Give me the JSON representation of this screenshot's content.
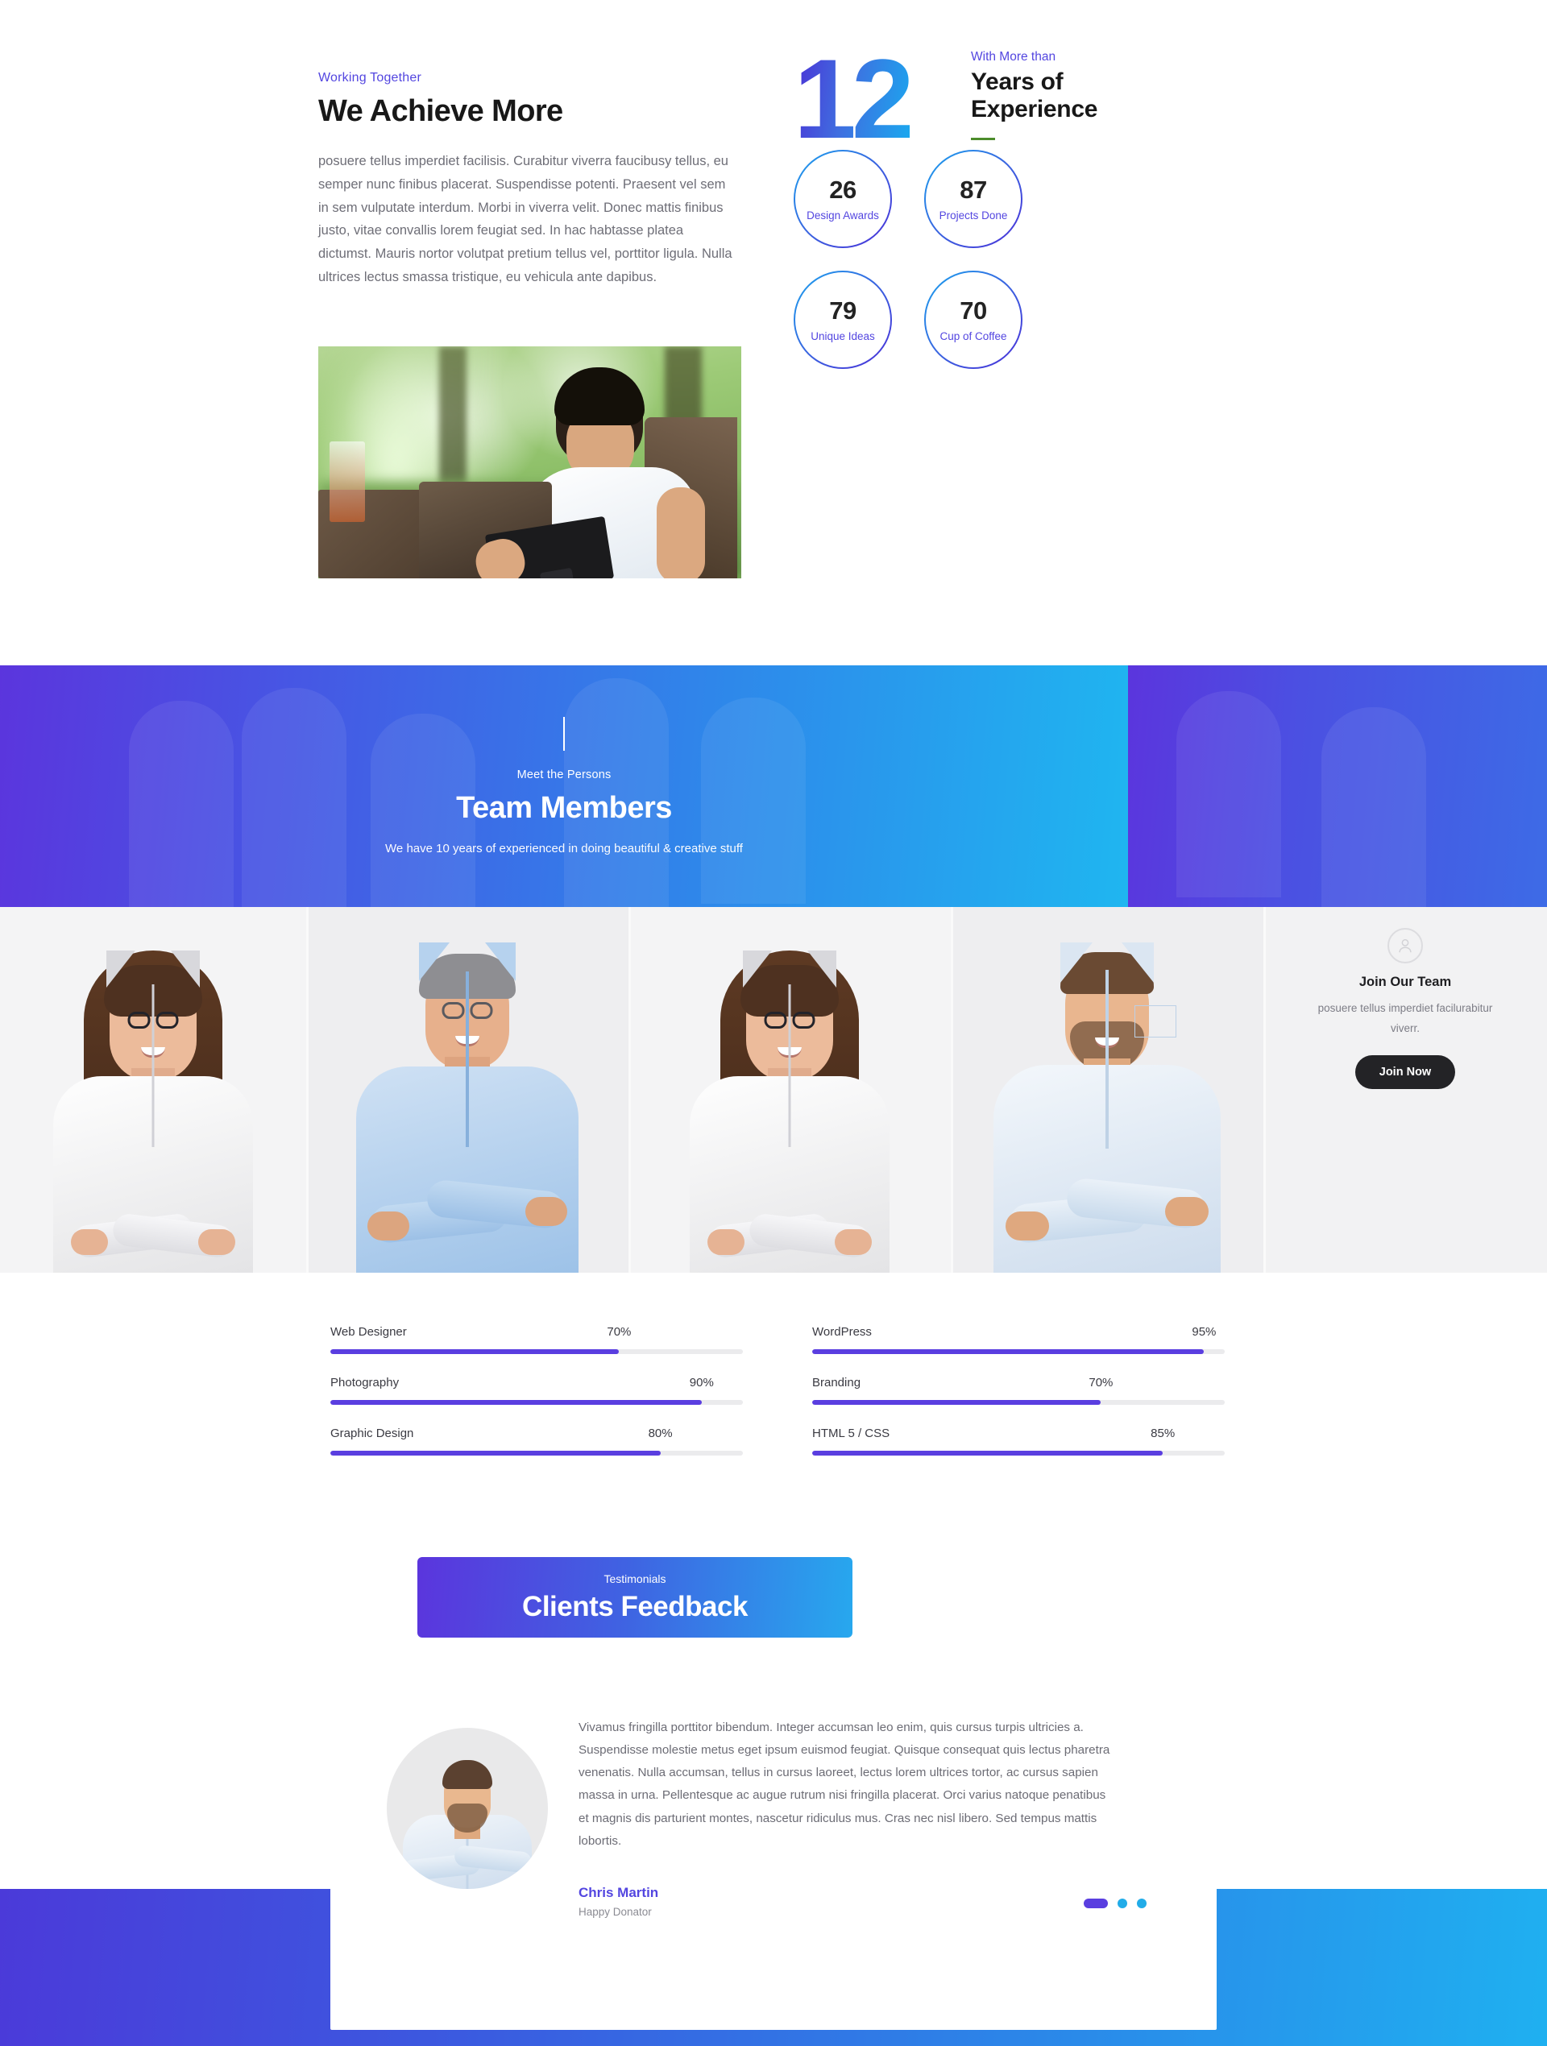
{
  "colors": {
    "accent_purple": "#5346e0",
    "accent_blue": "#1fb0f0",
    "gradient_start": "#5b35dd",
    "gradient_end": "#1fb6f0",
    "dark": "#232326",
    "green_rule": "#4c8c2b"
  },
  "achieve": {
    "eyebrow": "Working Together",
    "title": "We Achieve More",
    "body": "posuere tellus imperdiet facilisis. Curabitur viverra faucibusy tellus, eu semper nunc finibus placerat. Suspendisse potenti. Praesent vel sem in sem vulputate interdum. Morbi in viverra velit. Donec mattis finibus justo, vitae convallis lorem feugiat sed. In hac habtasse platea dictumst. Mauris nortor volutpat pretium tellus vel, porttitor ligula. Nulla ultrices lectus smassa tristique, eu vehicula ante dapibus.",
    "photo_alt": "man-with-tablet-photo"
  },
  "experience": {
    "number": "12",
    "eyebrow": "With More than",
    "title_line1": "Years of",
    "title_line2": "Experience"
  },
  "stats": [
    {
      "value": "26",
      "label": "Design Awards"
    },
    {
      "value": "87",
      "label": "Projects Done"
    },
    {
      "value": "79",
      "label": "Unique Ideas"
    },
    {
      "value": "70",
      "label": "Cup of Coffee"
    }
  ],
  "team_banner": {
    "eyebrow": "Meet the Persons",
    "title": "Team Members",
    "subtitle": "We have 10 years of experienced in doing beautiful & creative stuff"
  },
  "team_members": [
    {
      "photo_alt": "woman-with-glasses-photo-1"
    },
    {
      "photo_alt": "grey-haired-man-photo"
    },
    {
      "photo_alt": "woman-with-glasses-photo-2"
    },
    {
      "photo_alt": "bearded-man-photo"
    }
  ],
  "join": {
    "icon": "user-icon",
    "title": "Join Our Team",
    "description": "posuere tellus imperdiet facilurabitur viverr.",
    "button_label": "Join Now"
  },
  "skills": [
    {
      "name": "Web Designer",
      "percent": "70%",
      "value": 70
    },
    {
      "name": "WordPress",
      "percent": "95%",
      "value": 95
    },
    {
      "name": "Photography",
      "percent": "90%",
      "value": 90
    },
    {
      "name": "Branding",
      "percent": "70%",
      "value": 70
    },
    {
      "name": "Graphic Design",
      "percent": "80%",
      "value": 80
    },
    {
      "name": "HTML 5 / CSS",
      "percent": "85%",
      "value": 85
    }
  ],
  "feedback": {
    "eyebrow": "Testimonials",
    "title": "Clients Feedback"
  },
  "testimonial": {
    "avatar_alt": "chris-martin-avatar",
    "quote": "Vivamus fringilla porttitor bibendum. Integer accumsan leo enim, quis cursus turpis ultricies a. Suspendisse molestie metus eget ipsum euismod feugiat. Quisque consequat quis lectus pharetra venenatis. Nulla accumsan, tellus in cursus laoreet, lectus lorem ultrices tortor, ac cursus sapien massa in urna. Pellentesque ac augue rutrum nisi fringilla placerat. Orci varius natoque penatibus et magnis dis parturient montes, nascetur ridiculus mus. Cras nec nisl libero. Sed tempus mattis lobortis.",
    "name": "Chris Martin",
    "role": "Happy Donator",
    "slides": 3,
    "active_slide": 1
  }
}
